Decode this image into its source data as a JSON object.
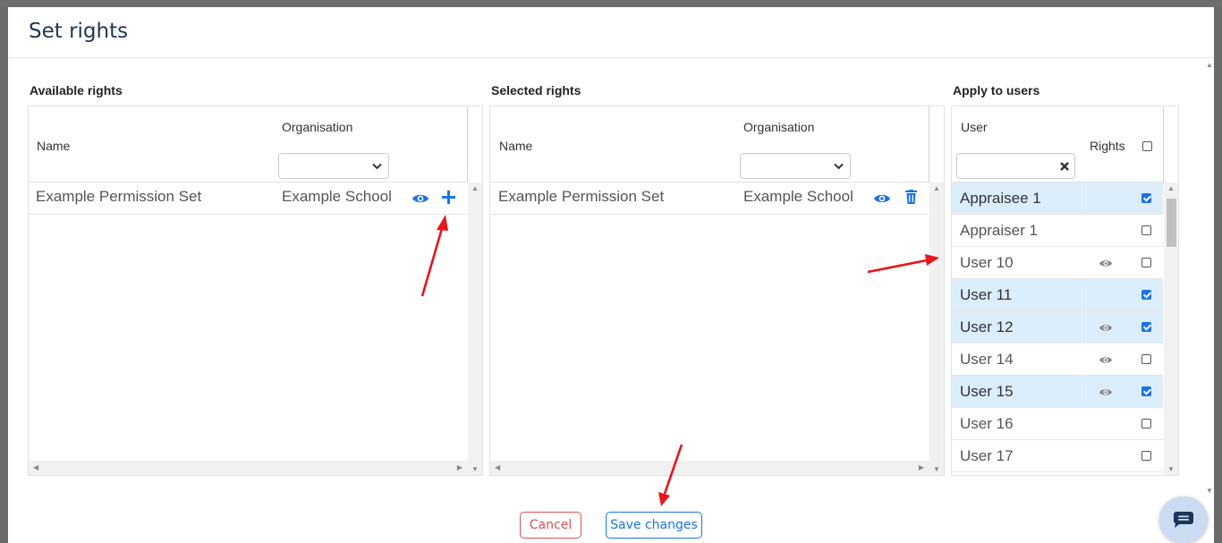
{
  "modal": {
    "title": "Set rights"
  },
  "available": {
    "label": "Available rights",
    "col_name": "Name",
    "col_org": "Organisation",
    "rows": [
      {
        "name": "Example Permission Set",
        "org": "Example School"
      }
    ]
  },
  "selected": {
    "label": "Selected rights",
    "col_name": "Name",
    "col_org": "Organisation",
    "rows": [
      {
        "name": "Example Permission Set",
        "org": "Example School"
      }
    ]
  },
  "apply": {
    "label": "Apply to users",
    "col_user": "User",
    "col_rights": "Rights",
    "search_value": "",
    "users": [
      {
        "name": "Appraisee 1",
        "rights_icon": false,
        "checked": true
      },
      {
        "name": "Appraiser 1",
        "rights_icon": false,
        "checked": false
      },
      {
        "name": "User 10",
        "rights_icon": true,
        "checked": false
      },
      {
        "name": "User 11",
        "rights_icon": false,
        "checked": true
      },
      {
        "name": "User 12",
        "rights_icon": true,
        "checked": true
      },
      {
        "name": "User 14",
        "rights_icon": true,
        "checked": false
      },
      {
        "name": "User 15",
        "rights_icon": true,
        "checked": true
      },
      {
        "name": "User 16",
        "rights_icon": false,
        "checked": false
      },
      {
        "name": "User 17",
        "rights_icon": false,
        "checked": false
      }
    ]
  },
  "footer": {
    "cancel_label": "Cancel",
    "save_label": "Save changes"
  },
  "colors": {
    "accent": "#1a73e8",
    "danger": "#d9534f",
    "selected_row": "#dcedfb",
    "annotation": "#e8141b"
  }
}
